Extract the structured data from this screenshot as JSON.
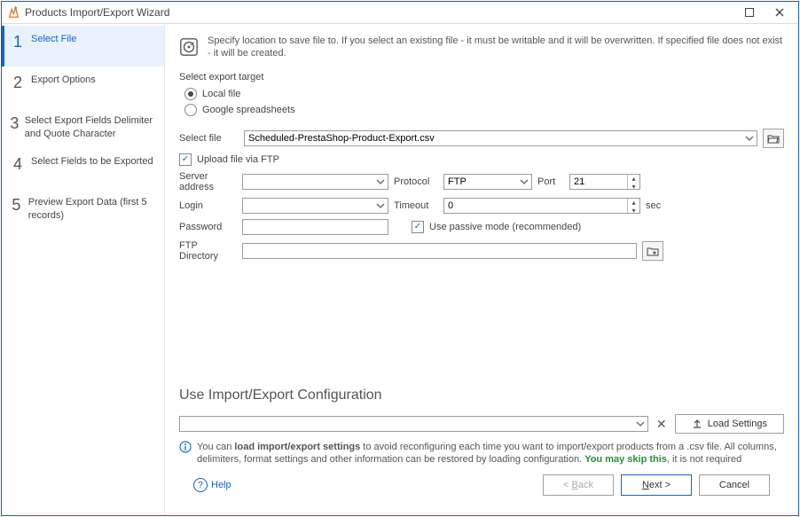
{
  "window": {
    "title": "Products Import/Export Wizard"
  },
  "sidebar": {
    "steps": [
      {
        "num": "1",
        "label": "Select File"
      },
      {
        "num": "2",
        "label": "Export Options"
      },
      {
        "num": "3",
        "label": "Select Export Fields Delimiter and Quote Character"
      },
      {
        "num": "4",
        "label": "Select Fields to be Exported"
      },
      {
        "num": "5",
        "label": "Preview Export Data (first 5 records)"
      }
    ]
  },
  "intro": {
    "text": "Specify location to save file to. If you select an existing file - it must be writable and it will be overwritten. If specified file does not exist - it will be created."
  },
  "exportTarget": {
    "label": "Select export target",
    "opt_local": "Local file",
    "opt_google": "Google spreadsheets"
  },
  "file": {
    "label": "Select file",
    "value": "Scheduled-PrestaShop-Product-Export.csv"
  },
  "ftp": {
    "upload_label": "Upload file via FTP",
    "server_label": "Server address",
    "server_value": "",
    "protocol_label": "Protocol",
    "protocol_value": "FTP",
    "port_label": "Port",
    "port_value": "21",
    "login_label": "Login",
    "login_value": "",
    "timeout_label": "Timeout",
    "timeout_value": "0",
    "timeout_unit": "sec",
    "password_label": "Password",
    "password_value": "",
    "passive_label": "Use passive mode (recommended)",
    "dir_label": "FTP Directory",
    "dir_value": ""
  },
  "config": {
    "title": "Use Import/Export Configuration",
    "dropdown_value": "",
    "load_btn": "Load Settings",
    "info_pre": "You can ",
    "info_bold": "load import/export settings",
    "info_mid": " to avoid reconfiguring each time you want to import/export products from a .csv file. All columns, delimiters, format settings and other information can be restored by loading configuration. ",
    "info_skip": "You may skip this",
    "info_post": ", it is not required"
  },
  "footer": {
    "help": "Help",
    "back_pre": "< ",
    "back_ul": "B",
    "back_post": "ack",
    "next_ul": "N",
    "next_post": "ext >",
    "cancel": "Cancel"
  }
}
